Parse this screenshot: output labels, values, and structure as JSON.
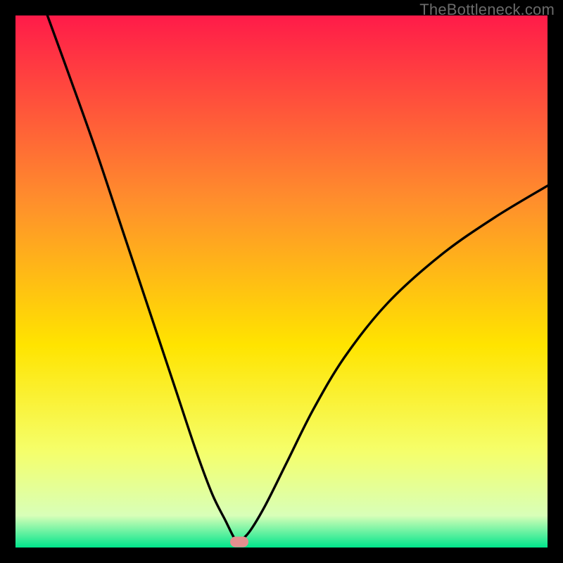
{
  "watermark": "TheBottleneck.com",
  "colors": {
    "top": "#ff1b49",
    "mid_upper": "#ff8f2c",
    "mid": "#ffe400",
    "mid_lower": "#f5ff6b",
    "near_bottom": "#d8ffb8",
    "bottom": "#00e58c",
    "curve": "#000000",
    "marker": "#e48f8f",
    "frame": "#000000"
  },
  "chart_data": {
    "type": "line",
    "title": "",
    "xlabel": "",
    "ylabel": "",
    "xlim": [
      0,
      100
    ],
    "ylim": [
      0,
      100
    ],
    "grid": false,
    "legend_position": "none",
    "marker": {
      "x": 42,
      "y": 1
    },
    "series": [
      {
        "name": "left-branch",
        "x": [
          6,
          10,
          15,
          20,
          25,
          30,
          34,
          37,
          39.5,
          41,
          42
        ],
        "y": [
          100,
          89,
          75,
          60,
          45,
          30,
          18,
          10,
          5,
          2,
          1
        ]
      },
      {
        "name": "right-branch",
        "x": [
          42,
          44,
          47,
          51,
          56,
          62,
          70,
          80,
          90,
          100
        ],
        "y": [
          1,
          3,
          8,
          16,
          26,
          36,
          46,
          55,
          62,
          68
        ]
      }
    ]
  }
}
